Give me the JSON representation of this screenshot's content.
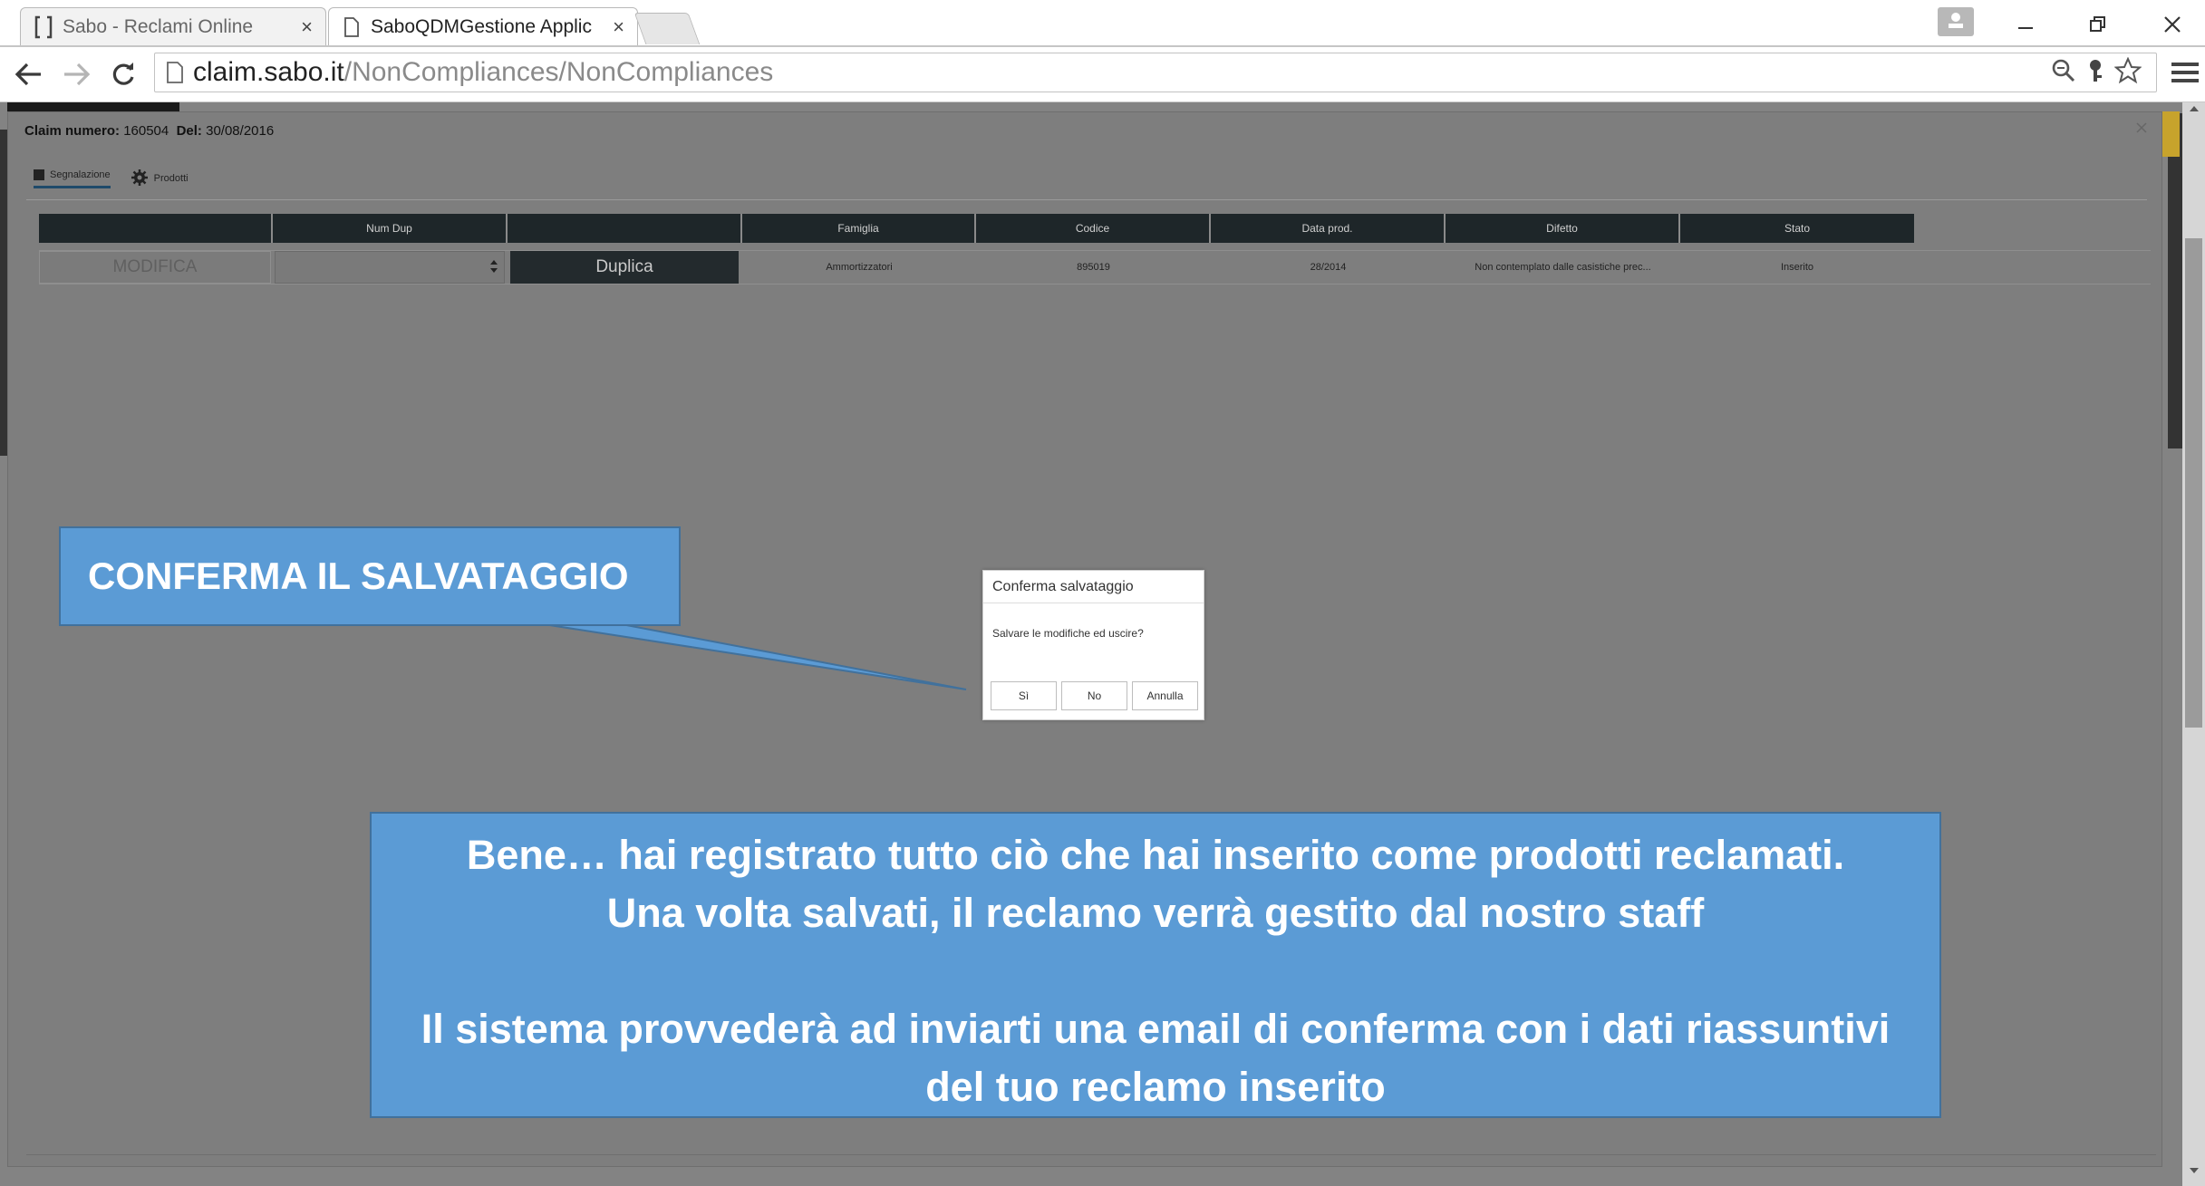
{
  "browser": {
    "tabs": [
      {
        "title": "Sabo - Reclami Online",
        "active": false
      },
      {
        "title": "SaboQDMGestione Applic",
        "active": true
      }
    ],
    "close_glyph": "×",
    "url_host": "claim.sabo.it",
    "url_path": "/NonCompliances/NonCompliances"
  },
  "modal": {
    "claim_label": "Claim numero:",
    "claim_number": "160504",
    "date_label": "Del:",
    "date_value": "30/08/2016",
    "tabs": [
      {
        "label": "Segnalazione",
        "icon": "document-icon"
      },
      {
        "label": "Prodotti",
        "icon": "gear-icon"
      }
    ]
  },
  "grid": {
    "columns": [
      "",
      "Num Dup",
      "",
      "Famiglia",
      "Codice",
      "Data prod.",
      "Difetto",
      "Stato"
    ],
    "row": {
      "action": "MODIFICA",
      "num_dup": "",
      "duplicate_button": "Duplica",
      "famiglia": "Ammortizzatori",
      "codice": "895019",
      "data_prod": "28/2014",
      "difetto": "Non contemplato dalle casistiche prec...",
      "stato": "Inserito"
    }
  },
  "dialog": {
    "title": "Conferma salvataggio",
    "message": "Salvare le modifiche ed uscire?",
    "buttons": {
      "yes": "Sì",
      "no": "No",
      "cancel": "Annulla"
    }
  },
  "callouts": {
    "confirm": "CONFERMA IL SALVATAGGIO",
    "info_line1": "Bene… hai registrato tutto ciò che hai  inserito come prodotti reclamati.",
    "info_line2": "Una volta salvati, il reclamo verrà gestito dal nostro staff",
    "info_line3": "Il sistema provvederà ad inviarti una email di conferma  con i dati riassuntivi",
    "info_line4": "del tuo reclamo inserito"
  },
  "colors": {
    "overlay": "#838383",
    "callout_fill": "#5b9bd5",
    "callout_border": "#41719c",
    "grid_header": "#1e2629"
  }
}
